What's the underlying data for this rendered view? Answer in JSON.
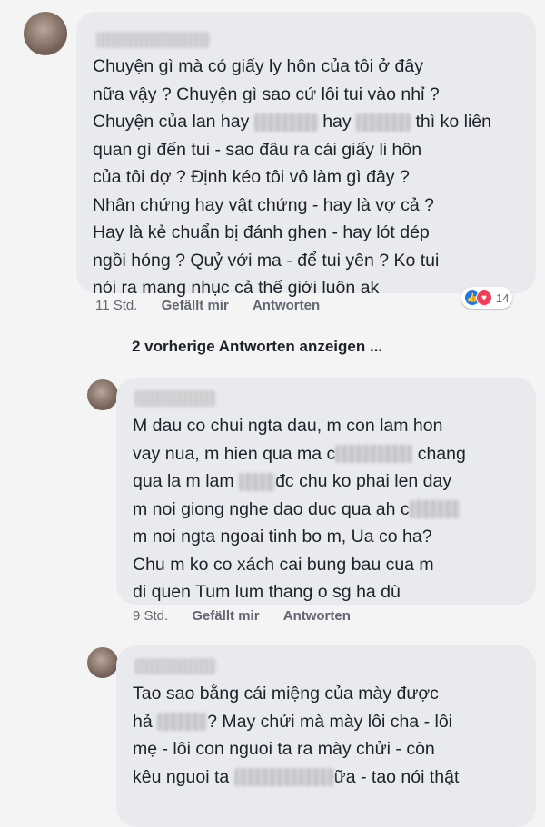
{
  "comments": [
    {
      "lines": [
        [
          {
            "t": "Chuyện gì mà có giấy ly hôn của tôi ở đây"
          }
        ],
        [
          {
            "t": "nữa vậy ? Chuyện gì sao cứ lôi tui vào nhỉ ?"
          }
        ],
        [
          {
            "t": "Chuyện của lan hay "
          },
          {
            "blur": 70
          },
          {
            "t": " hay "
          },
          {
            "blur": 60
          },
          {
            "t": " thì ko liên"
          }
        ],
        [
          {
            "t": "quan gì đến tui - sao đâu ra cái giấy li hôn"
          }
        ],
        [
          {
            "t": "của tôi dợ ? Định kéo tôi vô làm gì đây ?"
          }
        ],
        [
          {
            "t": "Nhân chứng hay vật chứng - hay là vợ cả ?"
          }
        ],
        [
          {
            "t": "Hay là kẻ chuẩn bị đánh ghen - hay lót dép"
          }
        ],
        [
          {
            "t": "ngồi hóng ? Quỷ với ma - để tui yên ? Ko tui"
          }
        ],
        [
          {
            "t": "nói ra mang nhục cả thế giới luôn ak"
          }
        ]
      ],
      "time": "11 Std.",
      "like": "Gefällt mir",
      "reply": "Antworten",
      "reaction_count": "14"
    },
    {
      "lines": [
        [
          {
            "t": "M dau co chui ngta dau, m con lam hon"
          }
        ],
        [
          {
            "t": "vay nua, m hien qua ma c"
          },
          {
            "blur": 85
          },
          {
            "t": " chang"
          }
        ],
        [
          {
            "t": "qua la m lam "
          },
          {
            "blur": 40
          },
          {
            "t": "đc chu ko phai len day"
          }
        ],
        [
          {
            "t": "m noi giong nghe dao duc qua ah c"
          },
          {
            "blur": 55
          }
        ],
        [
          {
            "t": "m noi ngta ngoai tinh bo m, Ua co ha?"
          }
        ],
        [
          {
            "t": "Chu m ko co xách cai bung bau cua m"
          }
        ],
        [
          {
            "t": "di quen Tum lum thang o sg ha dù"
          }
        ]
      ],
      "time": "9 Std.",
      "like": "Gefällt mir",
      "reply": "Antworten"
    },
    {
      "lines": [
        [
          {
            "t": "Tao sao bằng cái miệng của mày được"
          }
        ],
        [
          {
            "t": "hả "
          },
          {
            "blur": 55
          },
          {
            "t": "? May chửi mà mày lôi cha - lôi"
          }
        ],
        [
          {
            "t": "mẹ - lôi con nguoi ta ra mày chửi - còn"
          }
        ],
        [
          {
            "t": "kêu nguoi ta "
          },
          {
            "blur": 110
          },
          {
            "t": "ữa - tao nói thật"
          }
        ]
      ]
    }
  ],
  "previous_replies_label": "2 vorherige Antworten anzeigen ...",
  "icons": {
    "like": "thumbs-up-icon",
    "love": "heart-icon"
  },
  "colors": {
    "bubble": "#e9eaed",
    "background": "#f4f4f5",
    "like": "#1877f2",
    "love": "#f33e58"
  }
}
